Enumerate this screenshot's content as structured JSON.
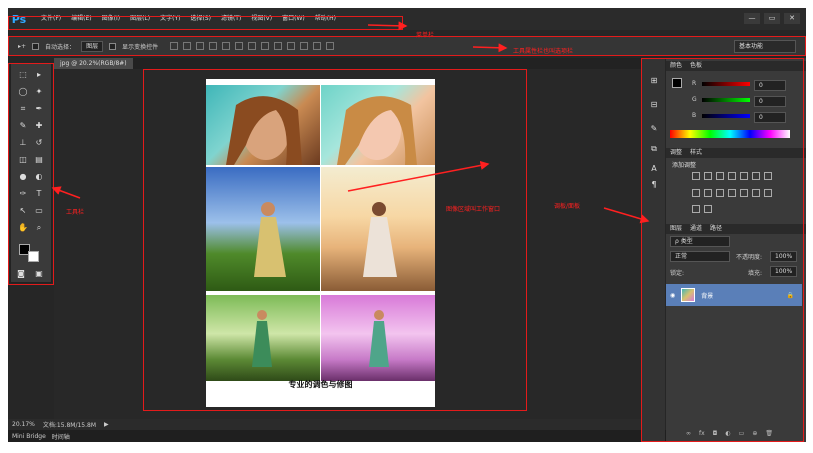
{
  "app": {
    "logo": "Ps",
    "menu": [
      "文件(F)",
      "编辑(E)",
      "图像(I)",
      "图层(L)",
      "文字(Y)",
      "选择(S)",
      "滤镜(T)",
      "视图(V)",
      "窗口(W)",
      "帮助(H)"
    ],
    "win_buttons": [
      "—",
      "▭",
      "✕"
    ]
  },
  "options": {
    "tool": "▸+",
    "auto_select_label": "自动选择：",
    "auto_select_value": "图层",
    "transform_label": "显示变换控件",
    "workspace": "基本功能"
  },
  "tools_icons": [
    "marquee-icon",
    "move-icon",
    "lasso-icon",
    "magic-wand-icon",
    "crop-icon",
    "eyedropper-icon",
    "brush-icon",
    "healing-icon",
    "stamp-icon",
    "history-brush-icon",
    "eraser-icon",
    "gradient-icon",
    "blur-icon",
    "dodge-icon",
    "pen-icon",
    "type-icon",
    "path-select-icon",
    "shape-icon",
    "hand-icon",
    "zoom-icon"
  ],
  "document": {
    "tab": "jpg @ 20.2%(RGB/8#)",
    "caption": "专业的调色与修图"
  },
  "status": {
    "zoom": "20.17%",
    "doc_size": "文档:15.8M/15.8M"
  },
  "bottom": {
    "left": "Mini Bridge",
    "right": "时间轴"
  },
  "panels": {
    "color": {
      "tabs": [
        "颜色",
        "色板"
      ],
      "channels": [
        {
          "label": "R",
          "value": "0"
        },
        {
          "label": "G",
          "value": "0"
        },
        {
          "label": "B",
          "value": "0"
        }
      ]
    },
    "adjust": {
      "tabs": [
        "调整",
        "样式"
      ],
      "title": "添加调整"
    },
    "layers": {
      "tabs": [
        "图层",
        "通道",
        "路径"
      ],
      "kind": "ρ 类型",
      "mode": "正常",
      "opacity_label": "不透明度:",
      "opacity": "100%",
      "lock_label": "锁定:",
      "fill_label": "填充:",
      "fill": "100%",
      "layer_name": "背景"
    }
  },
  "annotations": {
    "menu": "菜单栏",
    "options": "工具属性栏也叫选项栏",
    "tools": "工具栏",
    "canvas": "图像区域叫工作窗口",
    "panels": "调板/面板"
  },
  "colors": {
    "accent": "#31a8ff",
    "annotation": "#ff2020"
  }
}
